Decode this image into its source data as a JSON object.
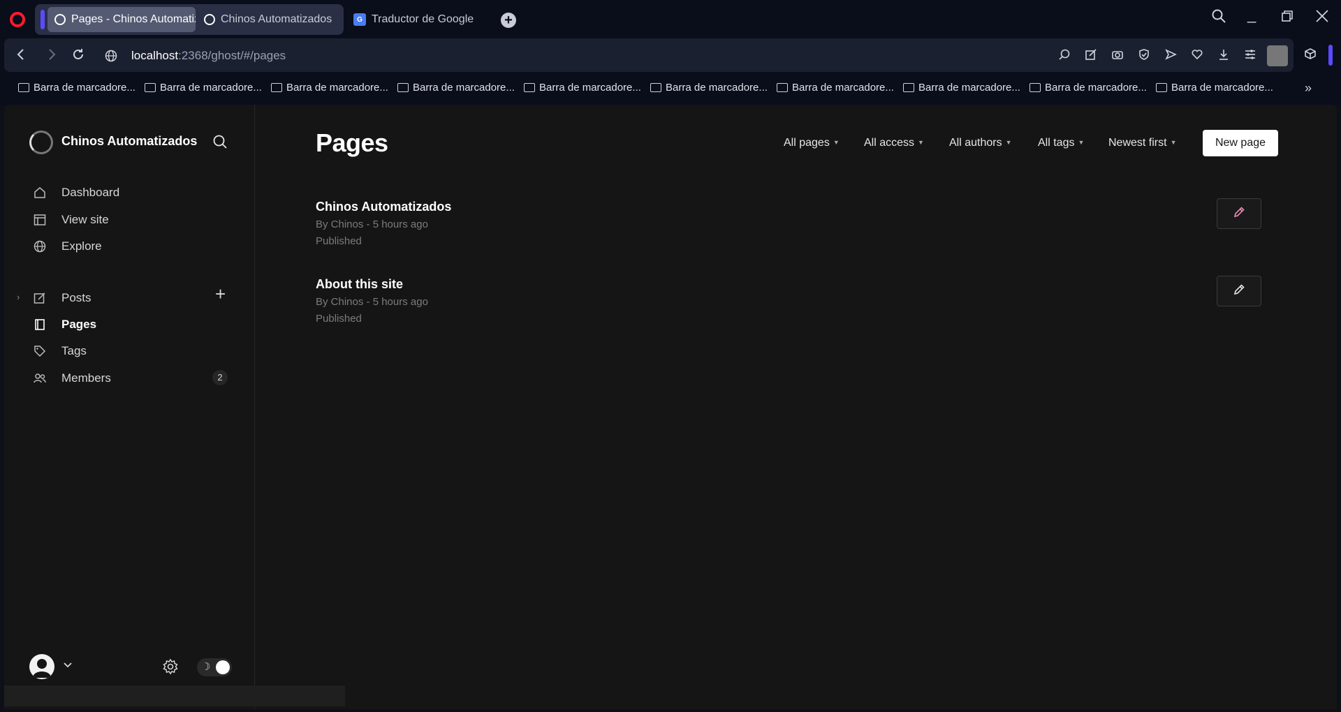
{
  "browser": {
    "tabs": [
      {
        "label": "Pages - Chinos Automatiz",
        "active": true
      },
      {
        "label": "Chinos Automatizados",
        "active": false
      },
      {
        "label": "Traductor de Google",
        "active": false
      }
    ],
    "url_host": "localhost",
    "url_rest": ":2368/ghost/#/pages",
    "bookmarks": [
      "Barra de marcadore...",
      "Barra de marcadore...",
      "Barra de marcadore...",
      "Barra de marcadore...",
      "Barra de marcadore...",
      "Barra de marcadore...",
      "Barra de marcadore...",
      "Barra de marcadore...",
      "Barra de marcadore...",
      "Barra de marcadore..."
    ]
  },
  "sidebar": {
    "site_name": "Chinos Automatizados",
    "items": [
      {
        "label": "Dashboard",
        "icon": "home-icon"
      },
      {
        "label": "View site",
        "icon": "layout-icon"
      },
      {
        "label": "Explore",
        "icon": "globe-icon"
      },
      {
        "label": "Posts",
        "icon": "edit-icon"
      },
      {
        "label": "Pages",
        "icon": "page-icon",
        "active": true
      },
      {
        "label": "Tags",
        "icon": "tag-icon"
      },
      {
        "label": "Members",
        "icon": "members-icon",
        "count": "2"
      }
    ]
  },
  "main": {
    "title": "Pages",
    "filters": {
      "type": "All pages",
      "access": "All access",
      "authors": "All authors",
      "tags": "All tags",
      "order": "Newest first"
    },
    "new_button": "New page",
    "pages": [
      {
        "title": "Chinos Automatizados",
        "meta": "By Chinos - 5 hours ago",
        "status": "Published",
        "edit_color": "#e88fb4"
      },
      {
        "title": "About this site",
        "meta": "By Chinos - 5 hours ago",
        "status": "Published",
        "edit_color": "#e6e6e6"
      }
    ]
  },
  "colors": {
    "accent": "#5b4bff",
    "opera_red": "#ff1b2d",
    "background": "#151515"
  }
}
